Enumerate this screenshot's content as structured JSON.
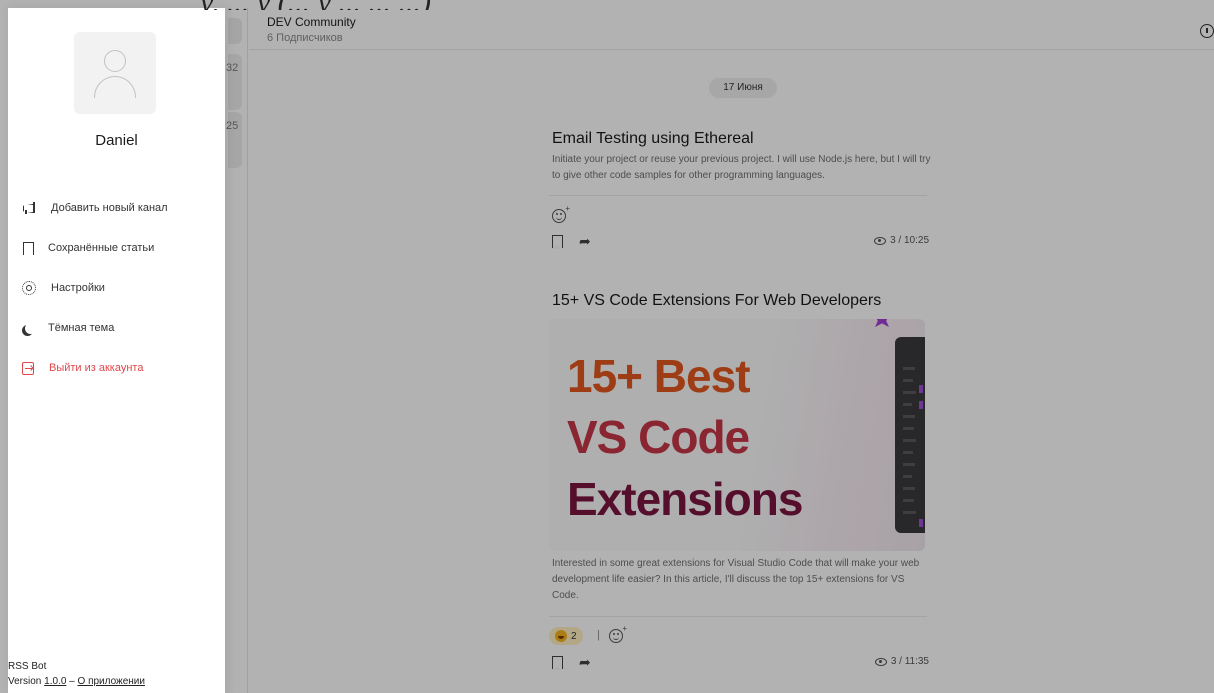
{
  "page": {
    "caption_fragment": "у, ... у (... у ... ... ...)"
  },
  "chat_list": {
    "times": [
      "32",
      "25"
    ]
  },
  "channel": {
    "title": "DEV Community",
    "subscribers": "6 Подписчиков"
  },
  "feed": {
    "date_chip": "17 Июня",
    "posts": [
      {
        "title": "Email Testing using Ethereal",
        "description": "Initiate your project or reuse your previous project. I will use Node.js here, but I will try to give other code samples for other programming languages.",
        "views": "3 / 10:25"
      },
      {
        "title": "15+ VS Code Extensions For Web Developers",
        "image_lines": [
          "15+ Best",
          "VS Code",
          "Extensions"
        ],
        "description": "Interested in some great extensions for Visual Studio Code that will make your web development life easier? In this article, I'll discuss the top 15+ extensions for VS Code.",
        "reaction_count": "2",
        "reaction_separator": "|",
        "views": "3 / 11:35"
      }
    ]
  },
  "drawer": {
    "profile_name": "Daniel",
    "menu": [
      {
        "label": "Добавить новый канал",
        "icon": "megaphone-icon"
      },
      {
        "label": "Сохранённые статьи",
        "icon": "bookmark-icon"
      },
      {
        "label": "Настройки",
        "icon": "gear-icon"
      },
      {
        "label": "Тёмная тема",
        "icon": "moon-icon"
      },
      {
        "label": "Выйти из аккаунта",
        "icon": "logout-icon",
        "color": "#e0474c"
      }
    ],
    "footer": {
      "app_name": "RSS Bot",
      "version_prefix": "Version",
      "version": "1.0.0",
      "separator": "–",
      "about_link": "О приложении"
    }
  },
  "colors": {
    "logout": "#e0474c",
    "image_line_1": "#e2571f",
    "image_line_2": "#c63548",
    "image_line_3": "#7a1640",
    "reaction_pill": "#fff1c2"
  }
}
